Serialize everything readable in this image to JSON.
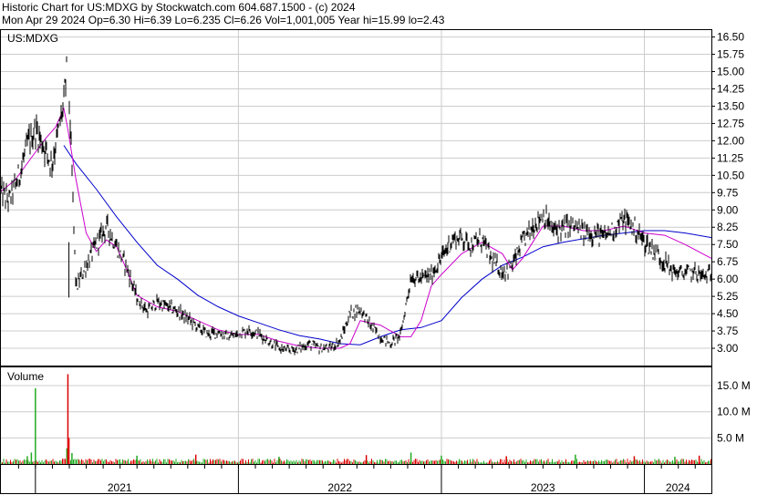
{
  "header": {
    "line1": "Historic Chart for US:MDXG by Stockwatch.com 604.687.1500 - (c) 2024",
    "line2": "Mon Apr 29 2024  Op=6.30  Hi=6.39  Lo=6.235  Cl=6.26  Vol=1,001,005  Year hi=15.99  lo=2.43"
  },
  "colors": {
    "price": "#000000",
    "ma_short": "#cc00cc",
    "ma_long": "#0000cc",
    "volume_up": "#22aa22",
    "volume_down": "#dd0000",
    "grid": "#cccccc"
  },
  "chart_data": [
    {
      "type": "line",
      "title": "US:MDXG",
      "x_labels": [
        "2021",
        "2022",
        "2023",
        "2024"
      ],
      "y_ticks": [
        "16.50",
        "15.75",
        "15.00",
        "14.25",
        "13.50",
        "12.75",
        "12.00",
        "11.25",
        "10.50",
        "9.75",
        "9.00",
        "8.25",
        "7.50",
        "6.75",
        "6.00",
        "5.25",
        "4.50",
        "3.75",
        "3.00"
      ],
      "ylim": [
        2.25,
        16.8
      ],
      "grid": true,
      "series": [
        {
          "name": "",
          "role": "price",
          "x": [
            2020.83,
            2020.87,
            2020.92,
            2020.96,
            2021.0,
            2021.04,
            2021.08,
            2021.11,
            2021.14,
            2021.155,
            2021.16,
            2021.2,
            2021.25,
            2021.3,
            2021.35,
            2021.4,
            2021.45,
            2021.5,
            2021.55,
            2021.6,
            2021.65,
            2021.7,
            2021.75,
            2021.8,
            2021.85,
            2021.9,
            2021.95,
            2022.0,
            2022.05,
            2022.1,
            2022.15,
            2022.2,
            2022.25,
            2022.3,
            2022.35,
            2022.4,
            2022.45,
            2022.5,
            2022.55,
            2022.6,
            2022.65,
            2022.7,
            2022.75,
            2022.8,
            2022.85,
            2022.9,
            2022.95,
            2023.0,
            2023.05,
            2023.1,
            2023.15,
            2023.2,
            2023.25,
            2023.3,
            2023.35,
            2023.4,
            2023.45,
            2023.5,
            2023.55,
            2023.6,
            2023.65,
            2023.7,
            2023.75,
            2023.8,
            2023.85,
            2023.9,
            2023.95,
            2024.0,
            2024.05,
            2024.1,
            2024.15,
            2024.2,
            2024.25,
            2024.29,
            2024.33
          ],
          "y": [
            9.8,
            9.4,
            10.5,
            11.8,
            12.5,
            11.8,
            11.0,
            12.3,
            13.6,
            15.2,
            15.5,
            5.6,
            6.6,
            7.5,
            8.3,
            7.4,
            6.5,
            5.2,
            4.6,
            5.0,
            4.8,
            4.6,
            4.3,
            3.9,
            3.6,
            3.7,
            3.5,
            3.6,
            3.8,
            3.6,
            3.3,
            3.0,
            2.9,
            3.0,
            3.2,
            3.0,
            3.0,
            3.3,
            4.5,
            4.7,
            4.0,
            3.5,
            3.2,
            3.6,
            6.1,
            6.0,
            6.2,
            6.9,
            7.7,
            7.8,
            7.5,
            7.7,
            6.8,
            6.3,
            6.6,
            7.6,
            8.3,
            8.8,
            8.1,
            8.2,
            8.3,
            8.0,
            8.0,
            7.8,
            8.2,
            8.6,
            8.2,
            7.6,
            7.2,
            6.7,
            6.3,
            6.26,
            6.3,
            6.1,
            6.26
          ]
        },
        {
          "name": "",
          "role": "ma_short",
          "x": [
            2020.83,
            2020.9,
            2021.0,
            2021.05,
            2021.1,
            2021.14,
            2021.16,
            2021.2,
            2021.25,
            2021.3,
            2021.35,
            2021.4,
            2021.45,
            2021.5,
            2021.6,
            2021.7,
            2021.8,
            2021.9,
            2022.0,
            2022.1,
            2022.2,
            2022.3,
            2022.4,
            2022.5,
            2022.55,
            2022.6,
            2022.7,
            2022.8,
            2022.85,
            2022.9,
            2022.95,
            2023.0,
            2023.1,
            2023.2,
            2023.3,
            2023.35,
            2023.4,
            2023.45,
            2023.5,
            2023.6,
            2023.7,
            2023.8,
            2023.9,
            2024.0,
            2024.1,
            2024.2,
            2024.33
          ],
          "y": [
            9.8,
            10.3,
            11.5,
            12.1,
            12.6,
            13.4,
            12.5,
            10.3,
            8.0,
            7.2,
            7.7,
            7.4,
            6.4,
            5.3,
            4.8,
            4.6,
            4.2,
            3.8,
            3.6,
            3.6,
            3.3,
            3.1,
            3.0,
            3.0,
            3.2,
            4.2,
            4.0,
            3.5,
            3.5,
            4.2,
            5.7,
            6.2,
            7.1,
            7.6,
            7.1,
            6.4,
            6.9,
            7.6,
            8.3,
            8.3,
            8.1,
            8.1,
            8.3,
            8.0,
            7.9,
            7.5,
            6.9
          ]
        },
        {
          "name": "",
          "role": "ma_long",
          "x": [
            2021.14,
            2021.2,
            2021.3,
            2021.4,
            2021.5,
            2021.6,
            2021.7,
            2021.8,
            2021.9,
            2022.0,
            2022.1,
            2022.2,
            2022.3,
            2022.4,
            2022.5,
            2022.6,
            2022.7,
            2022.8,
            2022.9,
            2023.0,
            2023.1,
            2023.2,
            2023.3,
            2023.4,
            2023.5,
            2023.6,
            2023.7,
            2023.8,
            2023.9,
            2024.0,
            2024.1,
            2024.2,
            2024.33
          ],
          "y": [
            11.8,
            11.0,
            9.9,
            8.7,
            7.6,
            6.6,
            6.0,
            5.3,
            4.8,
            4.4,
            4.1,
            3.8,
            3.55,
            3.4,
            3.2,
            3.15,
            3.5,
            3.8,
            3.9,
            4.2,
            5.2,
            6.0,
            6.6,
            6.95,
            7.4,
            7.6,
            7.75,
            7.9,
            8.0,
            8.1,
            8.1,
            8.0,
            7.8
          ]
        }
      ]
    },
    {
      "type": "bar",
      "title": "Volume",
      "y_ticks": [
        "15.0 M",
        "10.0 M",
        "5.0 M"
      ],
      "ylim": [
        0,
        18.5
      ],
      "x_labels": [
        "2021",
        "2022",
        "2023",
        "2024"
      ],
      "baseline_level_m": 0.6,
      "spikes": [
        {
          "x": 2020.96,
          "v": 1.5,
          "up": true
        },
        {
          "x": 2020.98,
          "v": 2.2,
          "up": true
        },
        {
          "x": 2021.0,
          "v": 14.5,
          "up": true
        },
        {
          "x": 2021.155,
          "v": 3.0,
          "up": true
        },
        {
          "x": 2021.16,
          "v": 17.2,
          "up": false
        },
        {
          "x": 2021.165,
          "v": 5.0,
          "up": false
        },
        {
          "x": 2021.18,
          "v": 2.1,
          "up": true
        },
        {
          "x": 2021.5,
          "v": 1.6,
          "up": true
        },
        {
          "x": 2021.79,
          "v": 1.8,
          "up": false
        },
        {
          "x": 2022.2,
          "v": 1.4,
          "up": true
        },
        {
          "x": 2022.63,
          "v": 1.7,
          "up": false
        },
        {
          "x": 2022.85,
          "v": 2.2,
          "up": true
        },
        {
          "x": 2023.0,
          "v": 1.6,
          "up": true
        },
        {
          "x": 2023.32,
          "v": 1.5,
          "up": false
        },
        {
          "x": 2023.66,
          "v": 1.8,
          "up": true
        },
        {
          "x": 2023.95,
          "v": 1.5,
          "up": false
        },
        {
          "x": 2024.15,
          "v": 1.4,
          "up": true
        },
        {
          "x": 2024.27,
          "v": 1.6,
          "up": false
        }
      ]
    }
  ]
}
